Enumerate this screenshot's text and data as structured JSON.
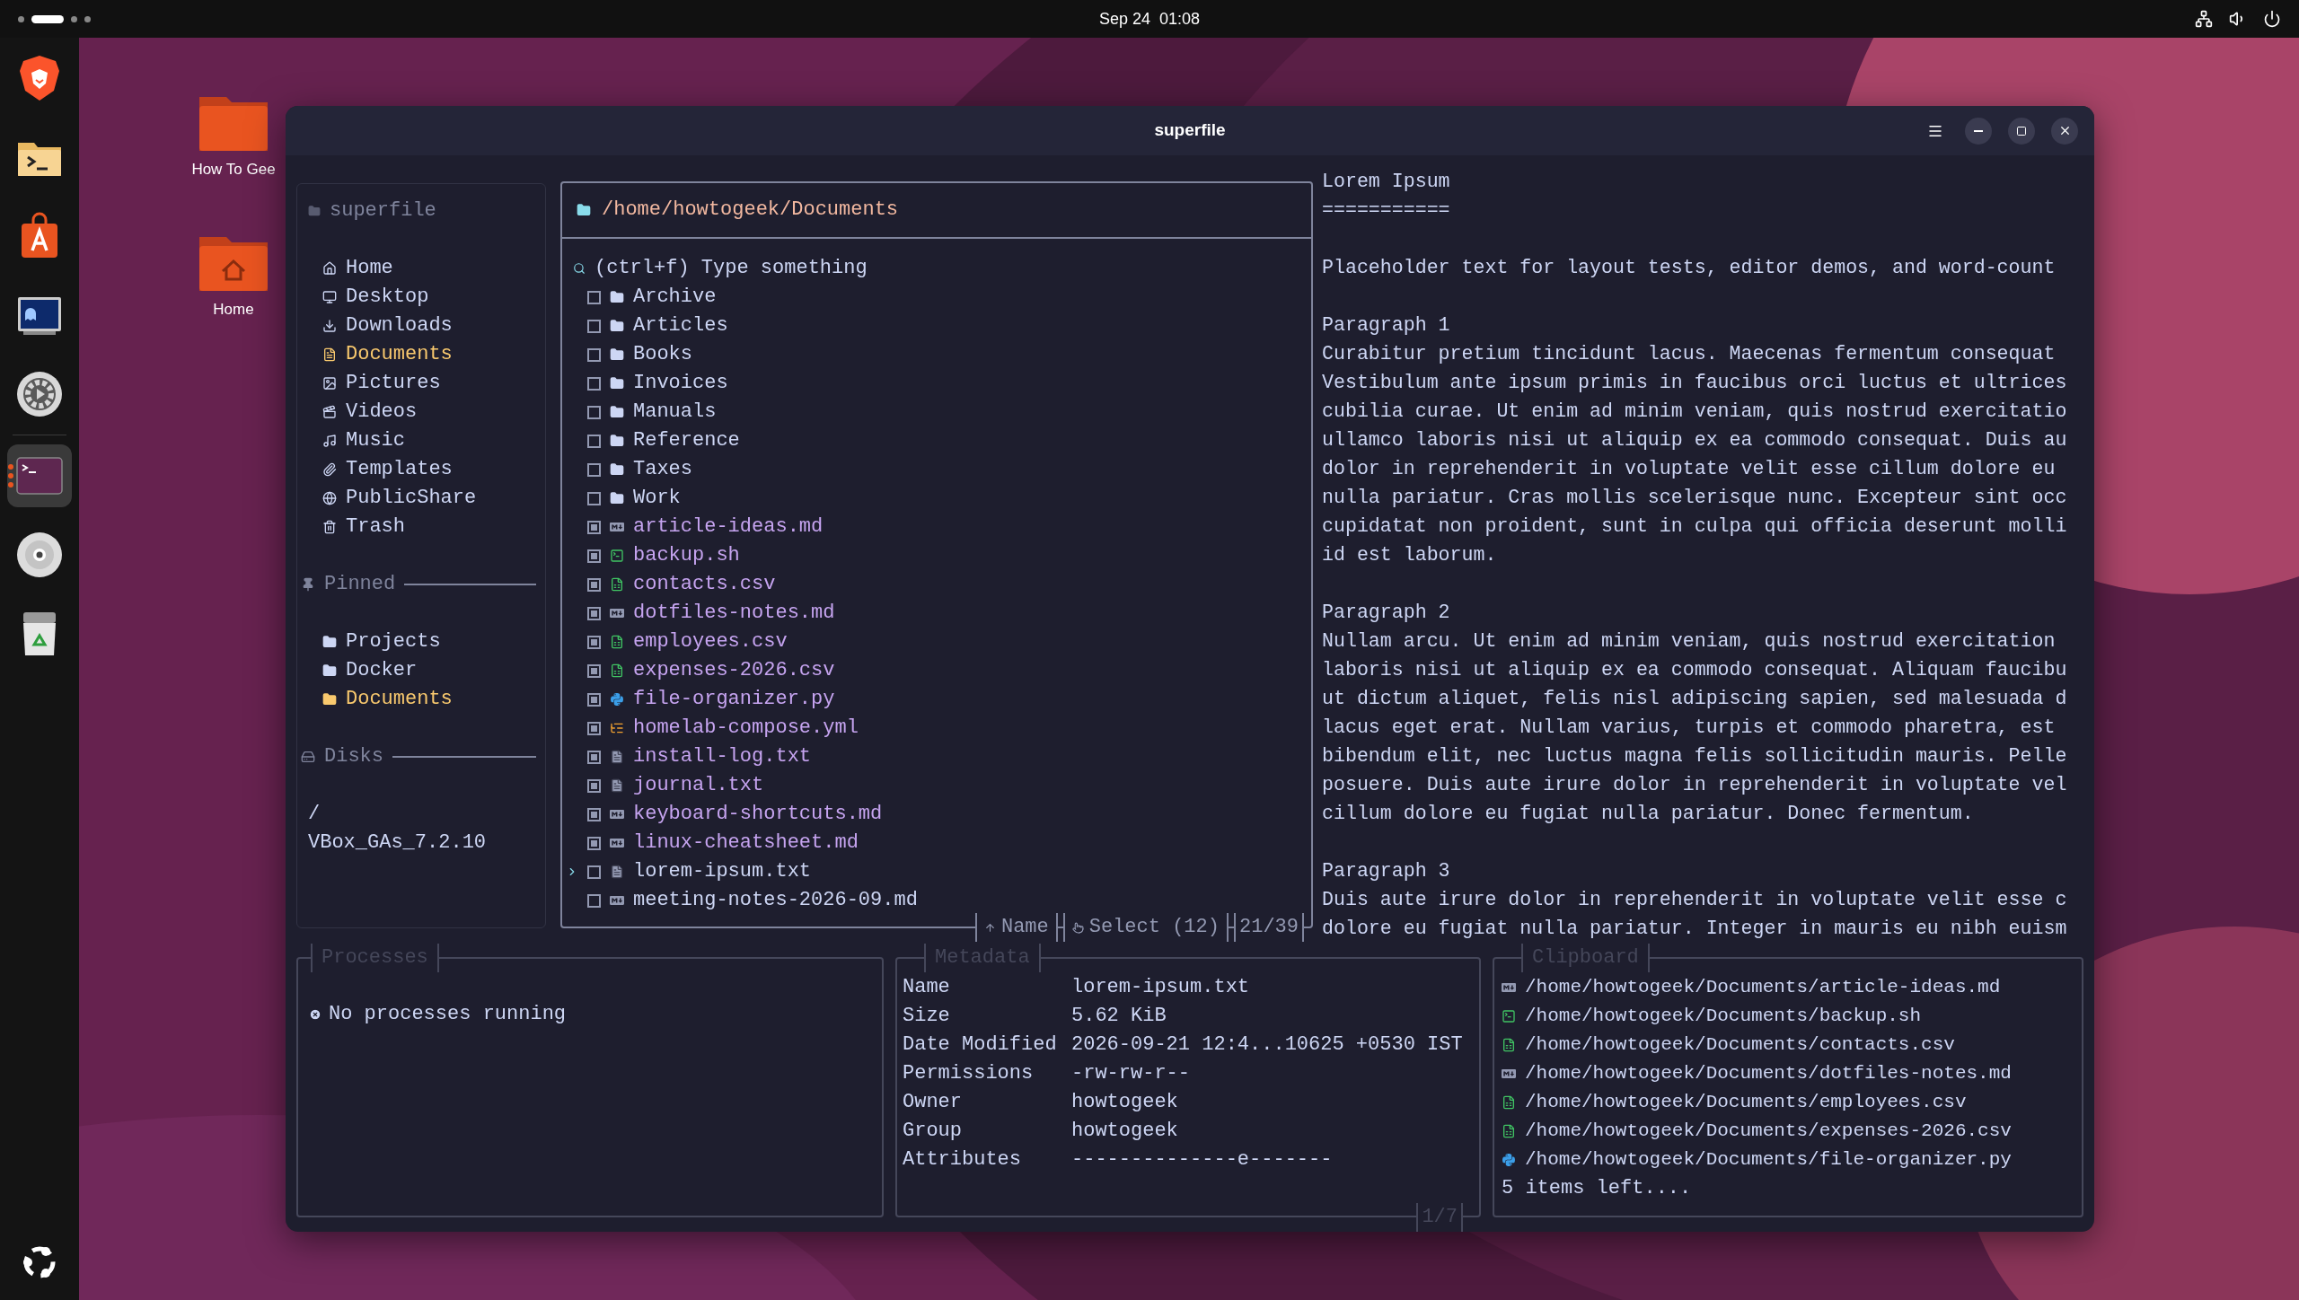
{
  "top_bar": {
    "clock": "Sep 24  01:08"
  },
  "dock": {
    "items": [
      {
        "kind": "browser",
        "selected": false
      },
      {
        "kind": "files",
        "selected": false
      },
      {
        "kind": "store",
        "selected": false
      },
      {
        "kind": "remote",
        "selected": false
      },
      {
        "kind": "settings",
        "selected": false
      },
      {
        "kind": "terminal",
        "selected": true
      },
      {
        "kind": "disc",
        "selected": false
      },
      {
        "kind": "trash",
        "selected": false
      }
    ]
  },
  "desktop_icons": [
    {
      "label": "How To Gee",
      "kind": "folder"
    },
    {
      "label": "Home",
      "kind": "home"
    }
  ],
  "window": {
    "title": "superfile"
  },
  "sidebar": {
    "title": "superfile",
    "items": [
      {
        "label": "Home",
        "kind": "home",
        "selected": false
      },
      {
        "label": "Desktop",
        "kind": "desktop",
        "selected": false
      },
      {
        "label": "Downloads",
        "kind": "downloads",
        "selected": false
      },
      {
        "label": "Documents",
        "kind": "documents",
        "selected": true
      },
      {
        "label": "Pictures",
        "kind": "pictures",
        "selected": false
      },
      {
        "label": "Videos",
        "kind": "videos",
        "selected": false
      },
      {
        "label": "Music",
        "kind": "music",
        "selected": false
      },
      {
        "label": "Templates",
        "kind": "templates",
        "selected": false
      },
      {
        "label": "PublicShare",
        "kind": "public",
        "selected": false
      },
      {
        "label": "Trash",
        "kind": "trash",
        "selected": false
      }
    ],
    "pinned": {
      "title": "Pinned",
      "items": [
        {
          "label": "Projects",
          "selected": false
        },
        {
          "label": "Docker",
          "selected": false
        },
        {
          "label": "Documents",
          "selected": true
        }
      ]
    },
    "disks": {
      "title": "Disks",
      "items": [
        {
          "label": "/"
        },
        {
          "label": "VBox_GAs_7.2.10"
        }
      ]
    }
  },
  "file_panel": {
    "path": "/home/howtogeek/Documents",
    "search": {
      "placeholder": "(ctrl+f) Type something"
    },
    "items": [
      {
        "name": "Archive",
        "kind": "folder",
        "checked": false,
        "selected": false
      },
      {
        "name": "Articles",
        "kind": "folder",
        "checked": false,
        "selected": false
      },
      {
        "name": "Books",
        "kind": "folder",
        "checked": false,
        "selected": false
      },
      {
        "name": "Invoices",
        "kind": "folder",
        "checked": false,
        "selected": false
      },
      {
        "name": "Manuals",
        "kind": "folder",
        "checked": false,
        "selected": false
      },
      {
        "name": "Reference",
        "kind": "folder",
        "checked": false,
        "selected": false
      },
      {
        "name": "Taxes",
        "kind": "folder",
        "checked": false,
        "selected": false
      },
      {
        "name": "Work",
        "kind": "folder",
        "checked": false,
        "selected": false
      },
      {
        "name": "article-ideas.md",
        "kind": "markdown",
        "checked": true,
        "selected": false
      },
      {
        "name": "backup.sh",
        "kind": "shell",
        "checked": true,
        "selected": false
      },
      {
        "name": "contacts.csv",
        "kind": "csv",
        "checked": true,
        "selected": false
      },
      {
        "name": "dotfiles-notes.md",
        "kind": "markdown",
        "checked": true,
        "selected": false
      },
      {
        "name": "employees.csv",
        "kind": "csv",
        "checked": true,
        "selected": false
      },
      {
        "name": "expenses-2026.csv",
        "kind": "csv",
        "checked": true,
        "selected": false
      },
      {
        "name": "file-organizer.py",
        "kind": "python",
        "checked": true,
        "selected": false
      },
      {
        "name": "homelab-compose.yml",
        "kind": "yaml",
        "checked": true,
        "selected": false
      },
      {
        "name": "install-log.txt",
        "kind": "text",
        "checked": true,
        "selected": false
      },
      {
        "name": "journal.txt",
        "kind": "text",
        "checked": true,
        "selected": false
      },
      {
        "name": "keyboard-shortcuts.md",
        "kind": "markdown",
        "checked": true,
        "selected": false
      },
      {
        "name": "linux-cheatsheet.md",
        "kind": "markdown",
        "checked": true,
        "selected": false
      },
      {
        "name": "lorem-ipsum.txt",
        "kind": "text",
        "checked": false,
        "selected": true
      },
      {
        "name": "meeting-notes-2026-09.md",
        "kind": "markdown",
        "checked": false,
        "selected": false
      }
    ],
    "footer": {
      "sort": "Name",
      "mode": "Select (12)",
      "position": "21/39"
    }
  },
  "preview": {
    "blocks": [
      [
        "Lorem Ipsum",
        "==========="
      ],
      [
        "Placeholder text for layout tests, editor demos, and word-count"
      ],
      [
        "Paragraph 1",
        "Curabitur pretium tincidunt lacus. Maecenas fermentum consequat",
        "Vestibulum ante ipsum primis in faucibus orci luctus et ultrices",
        "cubilia curae. Ut enim ad minim veniam, quis nostrud exercitatio",
        "ullamco laboris nisi ut aliquip ex ea commodo consequat. Duis au",
        "dolor in reprehenderit in voluptate velit esse cillum dolore eu",
        "nulla pariatur. Cras mollis scelerisque nunc. Excepteur sint occ",
        "cupidatat non proident, sunt in culpa qui officia deserunt molli",
        "id est laborum."
      ],
      [
        "Paragraph 2",
        "Nullam arcu. Ut enim ad minim veniam, quis nostrud exercitation",
        "laboris nisi ut aliquip ex ea commodo consequat. Aliquam faucibu",
        "ut dictum aliquet, felis nisl adipiscing sapien, sed malesuada d",
        "lacus eget erat. Nullam varius, turpis et commodo pharetra, est",
        "bibendum elit, nec luctus magna felis sollicitudin mauris. Pelle",
        "posuere. Duis aute irure dolor in reprehenderit in voluptate vel",
        "cillum dolore eu fugiat nulla pariatur. Donec fermentum."
      ],
      [
        "Paragraph 3",
        "Duis aute irure dolor in reprehenderit in voluptate velit esse c",
        "dolore eu fugiat nulla pariatur. Integer in mauris eu nibh euism"
      ]
    ]
  },
  "processes": {
    "title": "Processes",
    "message": "No processes running"
  },
  "metadata": {
    "title": "Metadata",
    "rows": [
      {
        "label": "Name",
        "value": "lorem-ipsum.txt"
      },
      {
        "label": "Size",
        "value": "5.62 KiB"
      },
      {
        "label": "Date Modified",
        "value": "2026-09-21 12:4...10625 +0530 IST"
      },
      {
        "label": "Permissions",
        "value": "-rw-rw-r--"
      },
      {
        "label": "Owner",
        "value": "howtogeek"
      },
      {
        "label": "Group",
        "value": "howtogeek"
      },
      {
        "label": "Attributes",
        "value": "--------------e-------"
      }
    ],
    "footer": "1/7"
  },
  "clipboard": {
    "title": "Clipboard",
    "items": [
      {
        "path": "/home/howtogeek/Documents/article-ideas.md",
        "kind": "markdown"
      },
      {
        "path": "/home/howtogeek/Documents/backup.sh",
        "kind": "shell"
      },
      {
        "path": "/home/howtogeek/Documents/contacts.csv",
        "kind": "csv"
      },
      {
        "path": "/home/howtogeek/Documents/dotfiles-notes.md",
        "kind": "markdown"
      },
      {
        "path": "/home/howtogeek/Documents/employees.csv",
        "kind": "csv"
      },
      {
        "path": "/home/howtogeek/Documents/expenses-2026.csv",
        "kind": "csv"
      },
      {
        "path": "/home/howtogeek/Documents/file-organizer.py",
        "kind": "python"
      }
    ],
    "more": "5 items left...."
  }
}
